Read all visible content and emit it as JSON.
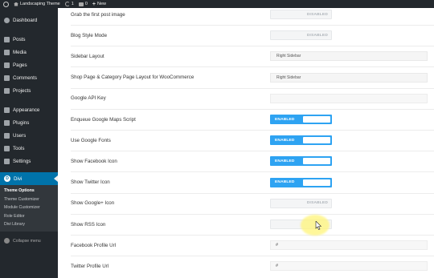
{
  "admin_bar": {
    "site_name": "Landscaping Theme",
    "updates_count": "1",
    "comments_count": "0",
    "new_label": "New"
  },
  "sidebar": {
    "items": [
      {
        "label": "Dashboard",
        "icon": "dashboard-icon"
      },
      {
        "label": "Posts",
        "icon": "pin-icon"
      },
      {
        "label": "Media",
        "icon": "media-icon"
      },
      {
        "label": "Pages",
        "icon": "pages-icon"
      },
      {
        "label": "Comments",
        "icon": "comment-icon"
      },
      {
        "label": "Projects",
        "icon": "pin-icon"
      },
      {
        "label": "Appearance",
        "icon": "brush-icon"
      },
      {
        "label": "Plugins",
        "icon": "plugin-icon"
      },
      {
        "label": "Users",
        "icon": "users-icon"
      },
      {
        "label": "Tools",
        "icon": "wrench-icon"
      },
      {
        "label": "Settings",
        "icon": "settings-icon"
      },
      {
        "label": "Divi",
        "icon": "divi-icon"
      }
    ],
    "divi_logo_letter": "D",
    "submenu": [
      "Theme Options",
      "Theme Customizer",
      "Module Customizer",
      "Role Editor",
      "Divi Library"
    ],
    "collapse_label": "Collapse menu"
  },
  "options": [
    {
      "label": "Grab the first post image",
      "type": "toggle",
      "state": "DISABLED"
    },
    {
      "label": "Blog Style Mode",
      "type": "toggle",
      "state": "DISABLED"
    },
    {
      "label": "Sidebar Layout",
      "type": "select",
      "value": "Right Sidebar"
    },
    {
      "label": "Shop Page & Category Page Layout for WooCommerce",
      "type": "select",
      "value": "Right Sidebar"
    },
    {
      "label": "Google API Key",
      "type": "text",
      "value": ""
    },
    {
      "label": "Enqueue Google Maps Script",
      "type": "toggle",
      "state": "ENABLED"
    },
    {
      "label": "Use Google Fonts",
      "type": "toggle",
      "state": "ENABLED"
    },
    {
      "label": "Show Facebook Icon",
      "type": "toggle",
      "state": "ENABLED"
    },
    {
      "label": "Show Twitter Icon",
      "type": "toggle",
      "state": "ENABLED"
    },
    {
      "label": "Show Google+ Icon",
      "type": "toggle",
      "state": "DISABLED"
    },
    {
      "label": "Show RSS Icon",
      "type": "toggle",
      "state": ""
    },
    {
      "label": "Facebook Profile Url",
      "type": "text",
      "value": "#"
    },
    {
      "label": "Twitter Profile Url",
      "type": "text",
      "value": "#"
    }
  ],
  "colors": {
    "toggle_enabled": "#2ea3f2",
    "sidebar_bg": "#23282d",
    "active_menu": "#0073aa",
    "cursor_highlight": "#fff478"
  }
}
